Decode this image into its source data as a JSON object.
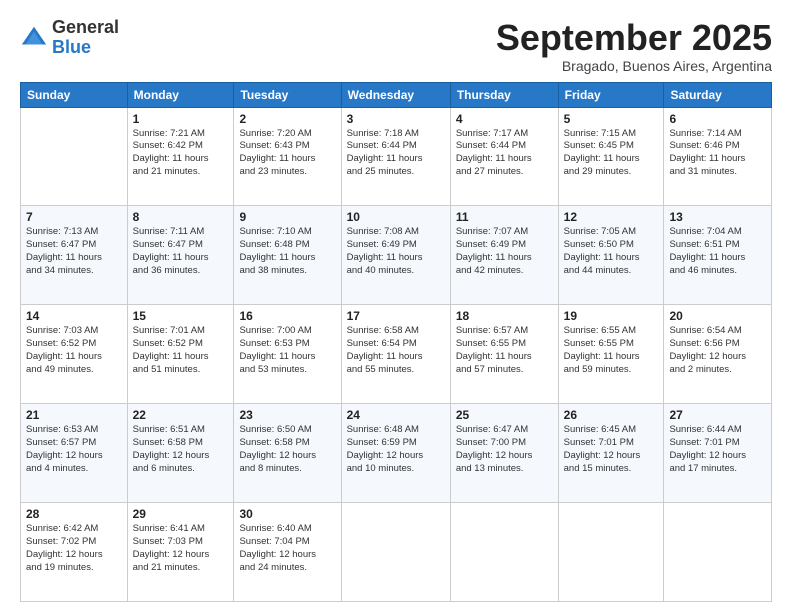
{
  "logo": {
    "general": "General",
    "blue": "Blue"
  },
  "header": {
    "month": "September 2025",
    "location": "Bragado, Buenos Aires, Argentina"
  },
  "days": [
    "Sunday",
    "Monday",
    "Tuesday",
    "Wednesday",
    "Thursday",
    "Friday",
    "Saturday"
  ],
  "weeks": [
    [
      {
        "num": "",
        "content": ""
      },
      {
        "num": "1",
        "content": "Sunrise: 7:21 AM\nSunset: 6:42 PM\nDaylight: 11 hours\nand 21 minutes."
      },
      {
        "num": "2",
        "content": "Sunrise: 7:20 AM\nSunset: 6:43 PM\nDaylight: 11 hours\nand 23 minutes."
      },
      {
        "num": "3",
        "content": "Sunrise: 7:18 AM\nSunset: 6:44 PM\nDaylight: 11 hours\nand 25 minutes."
      },
      {
        "num": "4",
        "content": "Sunrise: 7:17 AM\nSunset: 6:44 PM\nDaylight: 11 hours\nand 27 minutes."
      },
      {
        "num": "5",
        "content": "Sunrise: 7:15 AM\nSunset: 6:45 PM\nDaylight: 11 hours\nand 29 minutes."
      },
      {
        "num": "6",
        "content": "Sunrise: 7:14 AM\nSunset: 6:46 PM\nDaylight: 11 hours\nand 31 minutes."
      }
    ],
    [
      {
        "num": "7",
        "content": "Sunrise: 7:13 AM\nSunset: 6:47 PM\nDaylight: 11 hours\nand 34 minutes."
      },
      {
        "num": "8",
        "content": "Sunrise: 7:11 AM\nSunset: 6:47 PM\nDaylight: 11 hours\nand 36 minutes."
      },
      {
        "num": "9",
        "content": "Sunrise: 7:10 AM\nSunset: 6:48 PM\nDaylight: 11 hours\nand 38 minutes."
      },
      {
        "num": "10",
        "content": "Sunrise: 7:08 AM\nSunset: 6:49 PM\nDaylight: 11 hours\nand 40 minutes."
      },
      {
        "num": "11",
        "content": "Sunrise: 7:07 AM\nSunset: 6:49 PM\nDaylight: 11 hours\nand 42 minutes."
      },
      {
        "num": "12",
        "content": "Sunrise: 7:05 AM\nSunset: 6:50 PM\nDaylight: 11 hours\nand 44 minutes."
      },
      {
        "num": "13",
        "content": "Sunrise: 7:04 AM\nSunset: 6:51 PM\nDaylight: 11 hours\nand 46 minutes."
      }
    ],
    [
      {
        "num": "14",
        "content": "Sunrise: 7:03 AM\nSunset: 6:52 PM\nDaylight: 11 hours\nand 49 minutes."
      },
      {
        "num": "15",
        "content": "Sunrise: 7:01 AM\nSunset: 6:52 PM\nDaylight: 11 hours\nand 51 minutes."
      },
      {
        "num": "16",
        "content": "Sunrise: 7:00 AM\nSunset: 6:53 PM\nDaylight: 11 hours\nand 53 minutes."
      },
      {
        "num": "17",
        "content": "Sunrise: 6:58 AM\nSunset: 6:54 PM\nDaylight: 11 hours\nand 55 minutes."
      },
      {
        "num": "18",
        "content": "Sunrise: 6:57 AM\nSunset: 6:55 PM\nDaylight: 11 hours\nand 57 minutes."
      },
      {
        "num": "19",
        "content": "Sunrise: 6:55 AM\nSunset: 6:55 PM\nDaylight: 11 hours\nand 59 minutes."
      },
      {
        "num": "20",
        "content": "Sunrise: 6:54 AM\nSunset: 6:56 PM\nDaylight: 12 hours\nand 2 minutes."
      }
    ],
    [
      {
        "num": "21",
        "content": "Sunrise: 6:53 AM\nSunset: 6:57 PM\nDaylight: 12 hours\nand 4 minutes."
      },
      {
        "num": "22",
        "content": "Sunrise: 6:51 AM\nSunset: 6:58 PM\nDaylight: 12 hours\nand 6 minutes."
      },
      {
        "num": "23",
        "content": "Sunrise: 6:50 AM\nSunset: 6:58 PM\nDaylight: 12 hours\nand 8 minutes."
      },
      {
        "num": "24",
        "content": "Sunrise: 6:48 AM\nSunset: 6:59 PM\nDaylight: 12 hours\nand 10 minutes."
      },
      {
        "num": "25",
        "content": "Sunrise: 6:47 AM\nSunset: 7:00 PM\nDaylight: 12 hours\nand 13 minutes."
      },
      {
        "num": "26",
        "content": "Sunrise: 6:45 AM\nSunset: 7:01 PM\nDaylight: 12 hours\nand 15 minutes."
      },
      {
        "num": "27",
        "content": "Sunrise: 6:44 AM\nSunset: 7:01 PM\nDaylight: 12 hours\nand 17 minutes."
      }
    ],
    [
      {
        "num": "28",
        "content": "Sunrise: 6:42 AM\nSunset: 7:02 PM\nDaylight: 12 hours\nand 19 minutes."
      },
      {
        "num": "29",
        "content": "Sunrise: 6:41 AM\nSunset: 7:03 PM\nDaylight: 12 hours\nand 21 minutes."
      },
      {
        "num": "30",
        "content": "Sunrise: 6:40 AM\nSunset: 7:04 PM\nDaylight: 12 hours\nand 24 minutes."
      },
      {
        "num": "",
        "content": ""
      },
      {
        "num": "",
        "content": ""
      },
      {
        "num": "",
        "content": ""
      },
      {
        "num": "",
        "content": ""
      }
    ]
  ]
}
